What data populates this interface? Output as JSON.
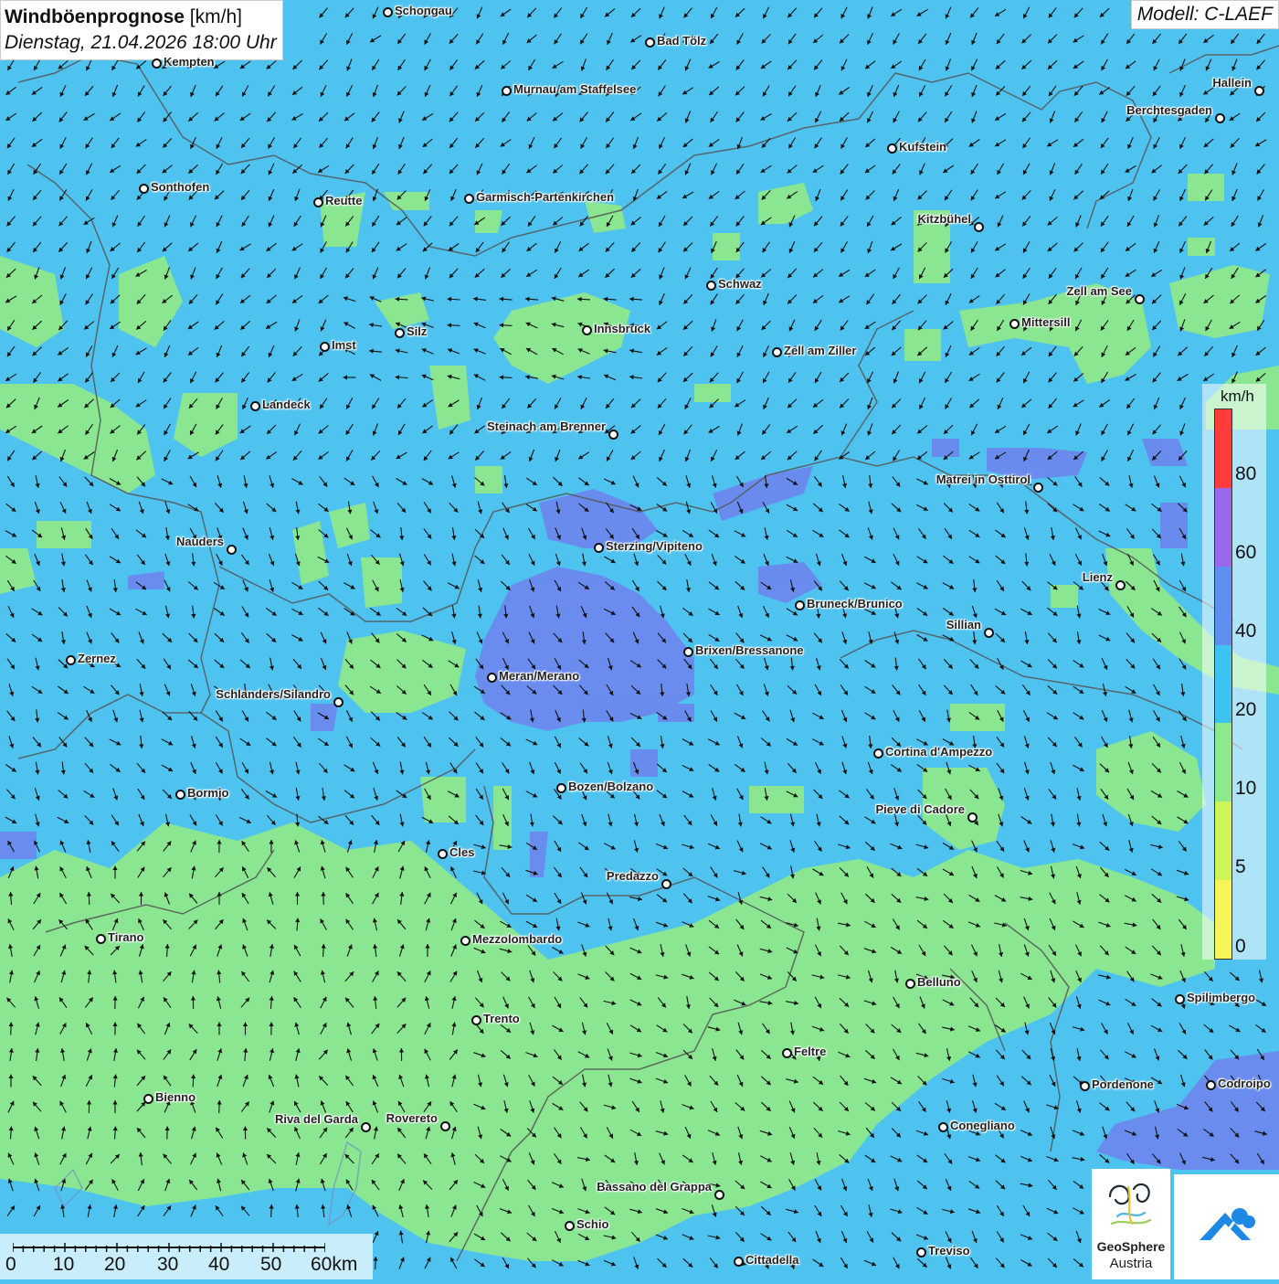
{
  "title": {
    "bold": "Windböenprognose",
    "unit": " [km/h]",
    "datetime": "Dienstag, 21.04.2026 18:00 Uhr"
  },
  "model": "Modell: C-LAEF",
  "legend": {
    "unit": "km/h",
    "labels": [
      "80",
      "60",
      "40",
      "20",
      "10",
      "5",
      "0"
    ],
    "colors": [
      "#ff3b3b",
      "#9966ee",
      "#5e8ff0",
      "#3cc4f0",
      "#8ee88c",
      "#ccf55a",
      "#f5f55a"
    ]
  },
  "scalebar": {
    "labels": [
      "0",
      "10",
      "20",
      "30",
      "40",
      "50",
      "60km"
    ]
  },
  "logo": {
    "name": "GeoSphere",
    "sub": "Austria"
  },
  "colors": {
    "sea": "#4fc3f0",
    "green": "#8ee88c",
    "purple": "#6e86ee",
    "border": "#555"
  },
  "cities": [
    {
      "name": "Schongau",
      "side": "r"
    },
    {
      "name": "Bad Tölz",
      "side": "r"
    },
    {
      "name": "Kempten",
      "side": "r"
    },
    {
      "name": "Murnau am Staffelsee",
      "side": "r"
    },
    {
      "name": "Hallein",
      "side": "l"
    },
    {
      "name": "Berchtesgaden",
      "side": "l"
    },
    {
      "name": "Kufstein",
      "side": "r"
    },
    {
      "name": "Sonthofen",
      "side": "r"
    },
    {
      "name": "Reutte",
      "side": "r"
    },
    {
      "name": "Garmisch-Partenkirchen",
      "side": "r"
    },
    {
      "name": "Kitzbühel",
      "side": "l"
    },
    {
      "name": "Schwaz",
      "side": "r"
    },
    {
      "name": "Zell am See",
      "side": "l"
    },
    {
      "name": "Mittersill",
      "side": "r"
    },
    {
      "name": "Innsbruck",
      "side": "r"
    },
    {
      "name": "Imst",
      "side": "r"
    },
    {
      "name": "Silz",
      "side": "r"
    },
    {
      "name": "Zell am Ziller",
      "side": "r"
    },
    {
      "name": "Landeck",
      "side": "r"
    },
    {
      "name": "Steinach am Brenner",
      "side": "l"
    },
    {
      "name": "Matrei in Osttirol",
      "side": "l"
    },
    {
      "name": "Nauders",
      "side": "l"
    },
    {
      "name": "Sterzing/Vipiteno",
      "side": "r"
    },
    {
      "name": "Lienz",
      "side": "l"
    },
    {
      "name": "Bruneck/Brunico",
      "side": "r"
    },
    {
      "name": "Sillian",
      "side": "l"
    },
    {
      "name": "Zernez",
      "side": "r"
    },
    {
      "name": "Brixen/Bressanone",
      "side": "r"
    },
    {
      "name": "Meran/Merano",
      "side": "r"
    },
    {
      "name": "Schlanders/Silandro",
      "side": "l"
    },
    {
      "name": "Cortina d'Ampezzo",
      "side": "r"
    },
    {
      "name": "Bormio",
      "side": "r"
    },
    {
      "name": "Bozen/Bolzano",
      "side": "r"
    },
    {
      "name": "Pieve di Cadore",
      "side": "l"
    },
    {
      "name": "Cles",
      "side": "r"
    },
    {
      "name": "Predazzo",
      "side": "l"
    },
    {
      "name": "Tirano",
      "side": "r"
    },
    {
      "name": "Mezzolombardo",
      "side": "r"
    },
    {
      "name": "Belluno",
      "side": "r"
    },
    {
      "name": "Spilimbergo",
      "side": "r"
    },
    {
      "name": "Trento",
      "side": "r"
    },
    {
      "name": "Feltre",
      "side": "r"
    },
    {
      "name": "Pordenone",
      "side": "r"
    },
    {
      "name": "Codroipo",
      "side": "r"
    },
    {
      "name": "Bienno",
      "side": "r"
    },
    {
      "name": "Riva del Garda",
      "side": "l"
    },
    {
      "name": "Rovereto",
      "side": "l"
    },
    {
      "name": "Conegliano",
      "side": "r"
    },
    {
      "name": "Bassano del Grappa",
      "side": "l"
    },
    {
      "name": "Schio",
      "side": "r"
    },
    {
      "name": "Treviso",
      "side": "r"
    },
    {
      "name": "Cittadella",
      "side": "r"
    }
  ]
}
